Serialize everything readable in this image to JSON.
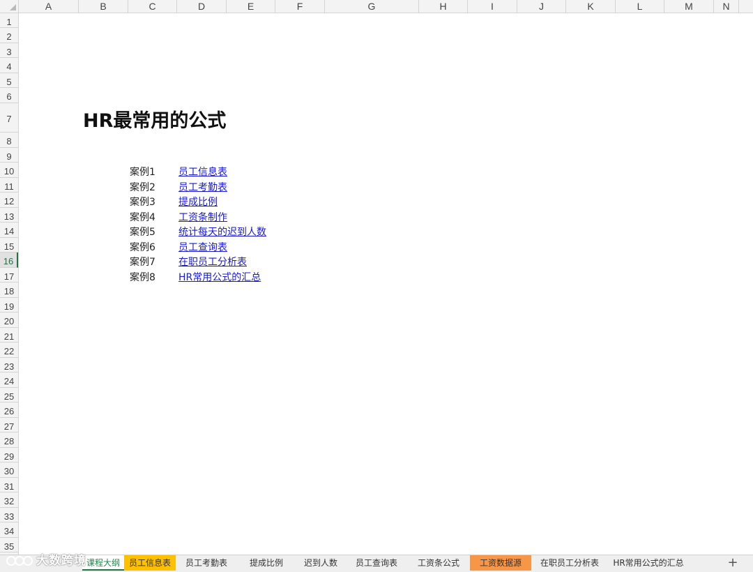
{
  "columns": [
    "A",
    "B",
    "C",
    "D",
    "E",
    "F",
    "G",
    "H",
    "I",
    "J",
    "K",
    "L",
    "M",
    "N"
  ],
  "rows": [
    "1",
    "2",
    "3",
    "4",
    "5",
    "6",
    "7",
    "8",
    "9",
    "10",
    "11",
    "12",
    "13",
    "14",
    "15",
    "16",
    "17",
    "18",
    "19",
    "20",
    "21",
    "22",
    "23",
    "24",
    "25",
    "26",
    "27",
    "28",
    "29",
    "30",
    "31",
    "32",
    "33",
    "34",
    "35"
  ],
  "selected_row": "16",
  "title": "HR最常用的公式",
  "cases": [
    {
      "label": "案例1",
      "link": "员工信息表"
    },
    {
      "label": "案例2",
      "link": "员工考勤表"
    },
    {
      "label": "案例3",
      "link": "提成比例"
    },
    {
      "label": "案例4",
      "link": "工资条制作"
    },
    {
      "label": "案例5",
      "link": "统计每天的迟到人数"
    },
    {
      "label": "案例6",
      "link": "员工查询表"
    },
    {
      "label": "案例7",
      "link": "在职员工分析表"
    },
    {
      "label": "案例8",
      "link": "HR常用公式的汇总"
    }
  ],
  "tabs": [
    {
      "label": "课程大纲",
      "active": true,
      "color": ""
    },
    {
      "label": "员工信息表",
      "active": false,
      "color": "#ffc000"
    },
    {
      "label": "员工考勤表",
      "active": false,
      "color": ""
    },
    {
      "label": "提成比例",
      "active": false,
      "color": ""
    },
    {
      "label": "迟到人数",
      "active": false,
      "color": ""
    },
    {
      "label": "员工查询表",
      "active": false,
      "color": ""
    },
    {
      "label": "工资条公式",
      "active": false,
      "color": ""
    },
    {
      "label": "工资数据源",
      "active": false,
      "color": "#f79646"
    },
    {
      "label": "在职员工分析表",
      "active": false,
      "color": ""
    },
    {
      "label": "HR常用公式的汇总",
      "active": false,
      "color": ""
    }
  ],
  "add_tab_icon": "plus-icon",
  "watermark": "大数跨境"
}
